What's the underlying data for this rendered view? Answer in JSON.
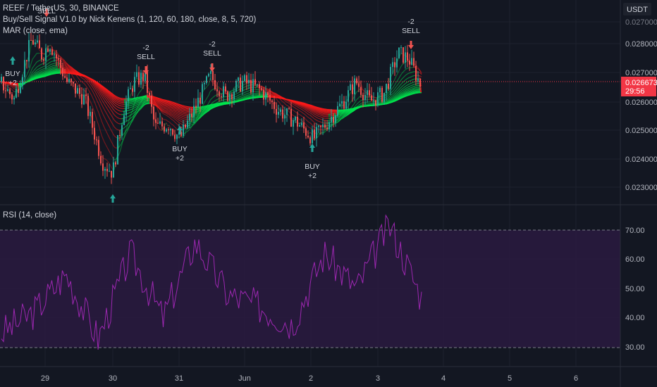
{
  "header": {
    "symbol_line": "REEF / TetherUS, 30, BINANCE",
    "indicator_1": "Buy/Sell Signal V1.0 by Nick Kenens (1, 120, 60, 180, close, 8, 5, 720)",
    "indicator_2": "MAR (close, ema)"
  },
  "price_axis": {
    "currency": "USDT",
    "ticks": [
      "0.027000",
      "0.028000",
      "0.027000",
      "0.026000",
      "0.025000",
      "0.024000",
      "0.023000"
    ],
    "current_price": "0.026673",
    "countdown": "29:56"
  },
  "rsi_panel": {
    "label": "RSI (14, close)",
    "ticks": [
      "70.00",
      "60.00",
      "50.00",
      "40.00",
      "30.00"
    ]
  },
  "time_axis": {
    "labels": [
      "29",
      "30",
      "31",
      "Jun",
      "2",
      "3",
      "4",
      "5",
      "6"
    ]
  },
  "signals": [
    {
      "type": "sell",
      "text": "SELL",
      "sub": ""
    },
    {
      "type": "buy",
      "text": "BUY",
      "sub": "+2"
    },
    {
      "type": "sell",
      "text": "SELL",
      "sub": "-2"
    },
    {
      "type": "buy",
      "text": "BUY",
      "sub": "+2"
    },
    {
      "type": "sell",
      "text": "SELL",
      "sub": "-2"
    },
    {
      "type": "buy",
      "text": "BUY",
      "sub": "+2"
    },
    {
      "type": "sell",
      "text": "SELL",
      "sub": "-2"
    },
    {
      "type": "buy",
      "text": "",
      "sub": ""
    }
  ],
  "colors": {
    "background": "#131722",
    "up_candle": "#26a69a",
    "down_candle": "#ef5350",
    "ribbon_bear": "#ff1a1a",
    "ribbon_bull": "#00e64d",
    "rsi_line": "#9c27b0",
    "rsi_band": "#2a1a3f",
    "price_label": "#f23645"
  },
  "chart_data": {
    "type": "candlestick",
    "price_series": {
      "name": "REEF / TetherUS",
      "x": [
        "May 28 18:00",
        "May 29",
        "May 29 12:00",
        "May 30",
        "May 30 12:00",
        "May 31",
        "May 31 12:00",
        "Jun 1",
        "Jun 1 12:00",
        "Jun 2",
        "Jun 2 12:00",
        "Jun 3",
        "Jun 3 12:00"
      ],
      "close": [
        0.0268,
        0.0276,
        0.0268,
        0.024,
        0.0265,
        0.0252,
        0.027,
        0.0265,
        0.026,
        0.025,
        0.0265,
        0.0263,
        0.0267
      ]
    },
    "rsi_series": {
      "name": "RSI (14, close)",
      "x": [
        "May 28 18:00",
        "May 29",
        "May 29 12:00",
        "May 30",
        "May 30 12:00",
        "May 31",
        "May 31 12:00",
        "Jun 1",
        "Jun 1 12:00",
        "Jun 2",
        "Jun 2 12:00",
        "Jun 3",
        "Jun 3 12:00",
        "Jun 3 18:00"
      ],
      "values": [
        35,
        42,
        55,
        33,
        62,
        40,
        66,
        48,
        44,
        38,
        62,
        50,
        72,
        47
      ]
    },
    "rsi_bands": [
      30,
      70
    ]
  }
}
